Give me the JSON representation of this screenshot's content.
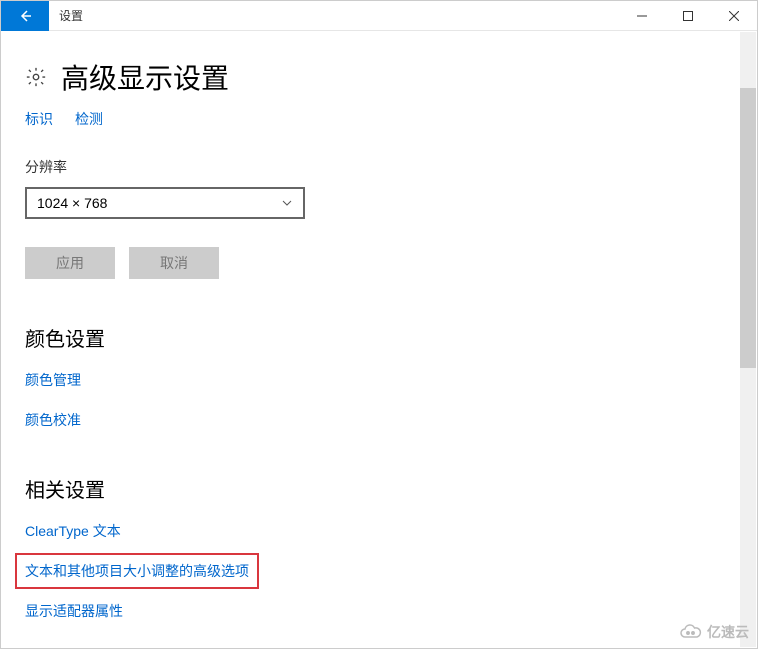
{
  "titlebar": {
    "title": "设置"
  },
  "page": {
    "heading": "高级显示设置",
    "identify_link": "标识",
    "detect_link": "检测"
  },
  "resolution": {
    "label": "分辨率",
    "value": "1024 × 768"
  },
  "buttons": {
    "apply": "应用",
    "cancel": "取消"
  },
  "color_section": {
    "heading": "颜色设置",
    "color_management": "颜色管理",
    "color_calibration": "颜色校准"
  },
  "related_section": {
    "heading": "相关设置",
    "cleartype": "ClearType 文本",
    "text_sizing": "文本和其他项目大小调整的高级选项",
    "adapter": "显示适配器属性"
  },
  "watermark": "亿速云"
}
